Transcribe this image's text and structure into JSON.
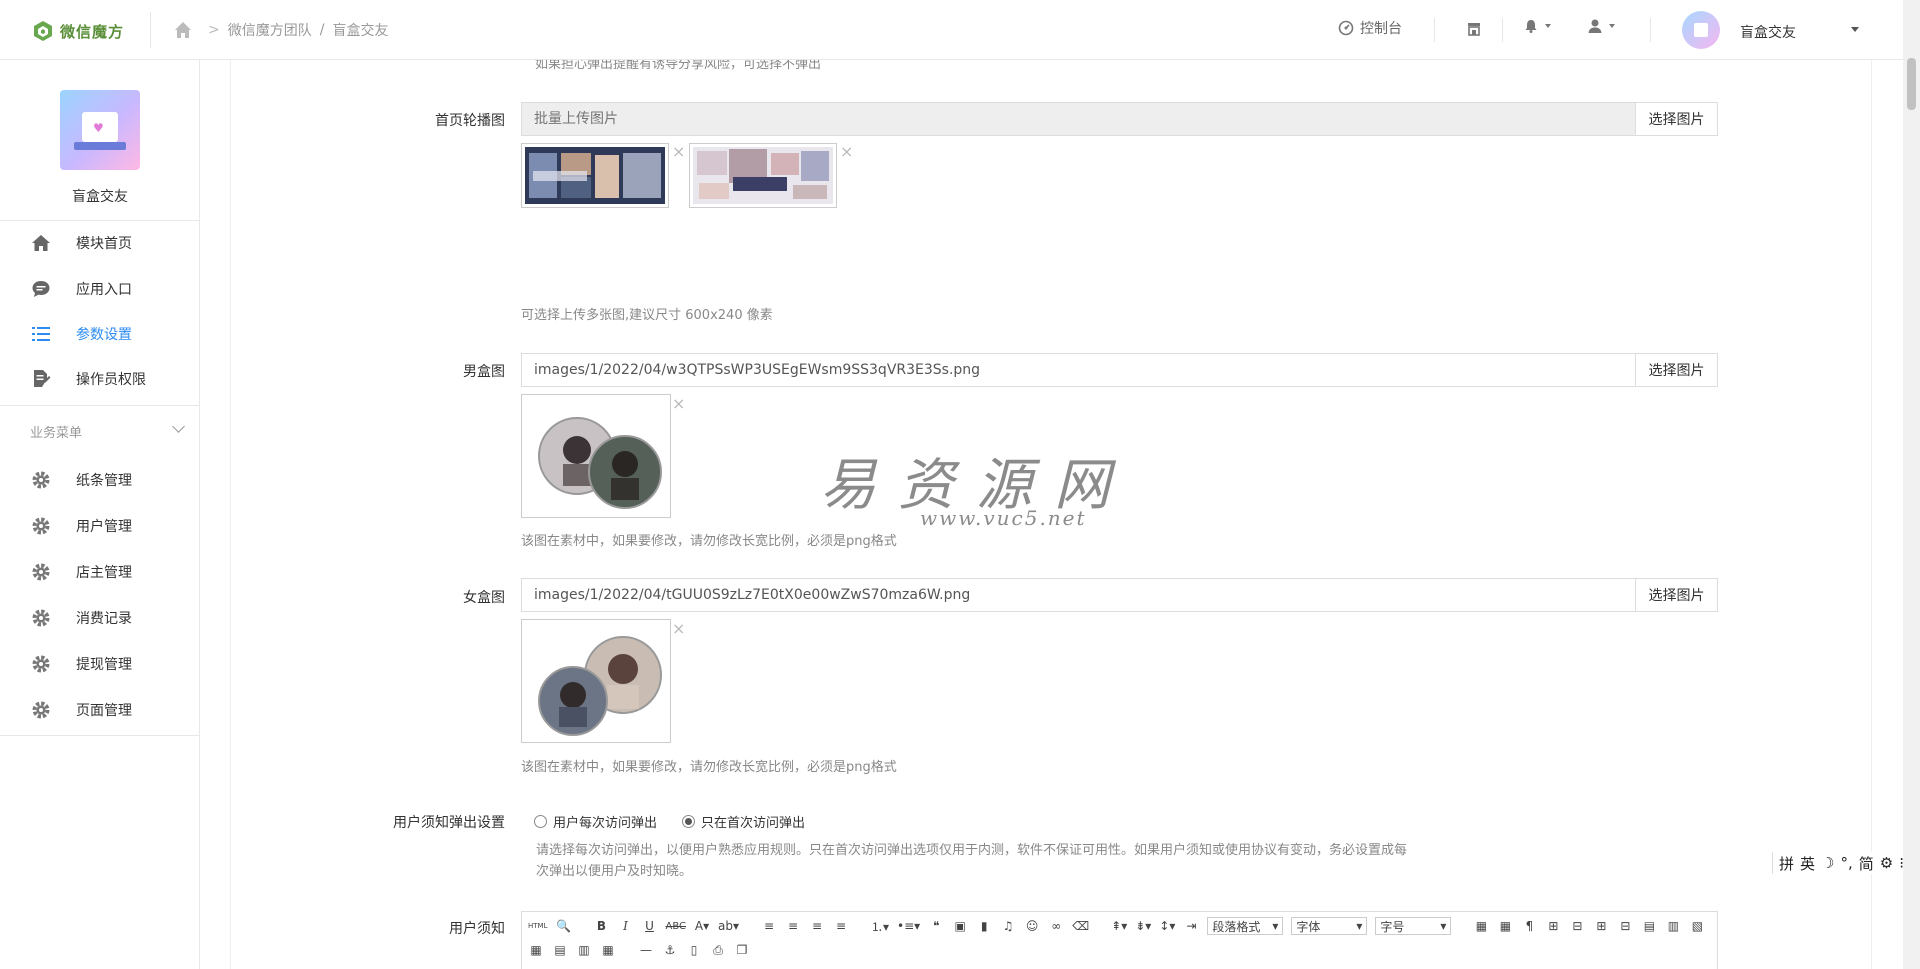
{
  "header": {
    "logo_text": "微信魔方",
    "breadcrumb": [
      "微信魔方团队",
      "盲盒交友"
    ],
    "breadcrumb_sep": "/",
    "console_label": "控制台",
    "user_name": "盲盒交友"
  },
  "sidebar": {
    "app_name": "盲盒交友",
    "top_items": [
      {
        "label": "模块首页",
        "icon": "home-icon"
      },
      {
        "label": "应用入口",
        "icon": "chat-bubble-icon"
      },
      {
        "label": "参数设置",
        "icon": "list-settings-icon",
        "active": true
      },
      {
        "label": "操作员权限",
        "icon": "document-edit-icon"
      }
    ],
    "group_title": "业务菜单",
    "group_items": [
      {
        "label": "纸条管理",
        "icon": "gear-icon"
      },
      {
        "label": "用户管理",
        "icon": "gear-icon"
      },
      {
        "label": "店主管理",
        "icon": "gear-icon"
      },
      {
        "label": "消费记录",
        "icon": "gear-icon"
      },
      {
        "label": "提现管理",
        "icon": "gear-icon"
      },
      {
        "label": "页面管理",
        "icon": "gear-icon"
      }
    ]
  },
  "form": {
    "top_cut_text": "如果担心弹出提醒有诱导分享风险，可选择不弹出",
    "banner": {
      "label": "首页轮播图",
      "placeholder": "批量上传图片",
      "button": "选择图片",
      "help": "可选择上传多张图,建议尺寸 600x240 像素"
    },
    "male_box": {
      "label": "男盒图",
      "value": "images/1/2022/04/w3QTPSsWP3USEgEWsm9SS3qVR3E3Ss.png",
      "button": "选择图片",
      "help": "该图在素材中，如果要修改，请勿修改长宽比例，必须是png格式"
    },
    "female_box": {
      "label": "女盒图",
      "value": "images/1/2022/04/tGUU0S9zLz7E0tX0e00wZwS70mza6W.png",
      "button": "选择图片",
      "help": "该图在素材中，如果要修改，请勿修改长宽比例，必须是png格式"
    },
    "notice_popup": {
      "label": "用户须知弹出设置",
      "options": [
        "用户每次访问弹出",
        "只在首次访问弹出"
      ],
      "selected": 1,
      "help": "请选择每次访问弹出，以便用户熟悉应用规则。只在首次访问弹出选项仅用于内测，软件不保证可用性。如果用户须知或使用协议有变动，务必设置成每次弹出以便用户及时知晓。"
    },
    "notice": {
      "label": "用户须知",
      "toolbar_selects": [
        "段落格式",
        "字体",
        "字号"
      ],
      "html_label": "HTML"
    }
  },
  "watermark": {
    "text": "易资源网",
    "url": "www.vuc5.net"
  },
  "ime": [
    "拼",
    "英",
    "简"
  ],
  "colors": {
    "active": "#2d8cf0",
    "brand_green": "#5b8f3a"
  }
}
